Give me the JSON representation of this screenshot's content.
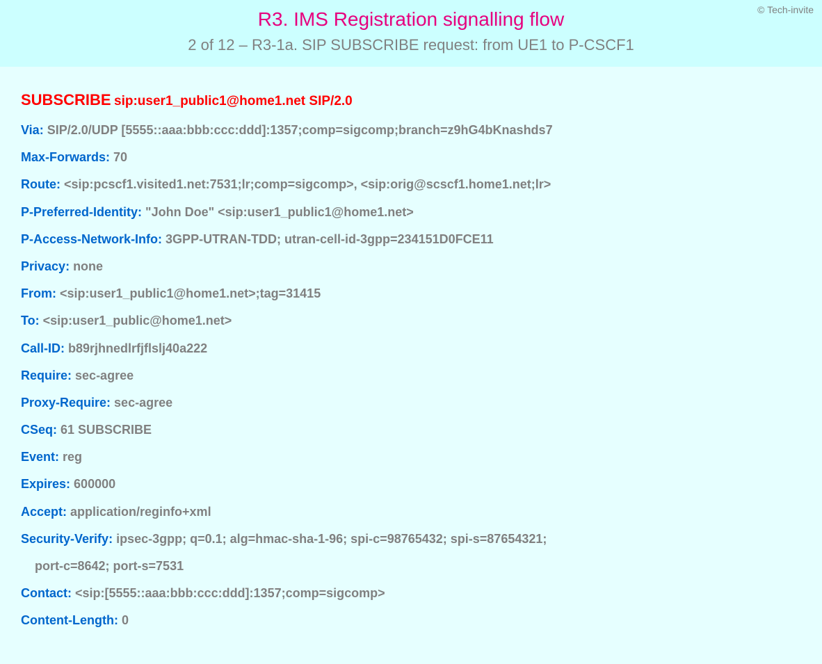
{
  "copyright": "© Tech-invite",
  "header": {
    "title": "R3. IMS Registration signalling flow",
    "subtitle": "2 of 12 – R3-1a. SIP SUBSCRIBE request: from UE1 to P-CSCF1"
  },
  "request": {
    "method": "SUBSCRIBE",
    "uri": "sip:user1_public1@home1.net SIP/2.0"
  },
  "sip_headers": [
    {
      "name": "Via",
      "value": "SIP/2.0/UDP [5555::aaa:bbb:ccc:ddd]:1357;comp=sigcomp;branch=z9hG4bKnashds7"
    },
    {
      "name": "Max-Forwards",
      "value": "70"
    },
    {
      "name": "Route",
      "value": "<sip:pcscf1.visited1.net:7531;lr;comp=sigcomp>, <sip:orig@scscf1.home1.net;lr>"
    },
    {
      "name": "P-Preferred-Identity",
      "value": "\"John Doe\" <sip:user1_public1@home1.net>"
    },
    {
      "name": "P-Access-Network-Info",
      "value": "3GPP-UTRAN-TDD; utran-cell-id-3gpp=234151D0FCE11"
    },
    {
      "name": "Privacy",
      "value": "none"
    },
    {
      "name": "From",
      "value": "<sip:user1_public1@home1.net>;tag=31415"
    },
    {
      "name": "To",
      "value": "<sip:user1_public@home1.net>"
    },
    {
      "name": "Call-ID",
      "value": "b89rjhnedlrfjflslj40a222"
    },
    {
      "name": "Require",
      "value": "sec-agree"
    },
    {
      "name": "Proxy-Require",
      "value": "sec-agree"
    },
    {
      "name": "CSeq",
      "value": "61 SUBSCRIBE"
    },
    {
      "name": "Event",
      "value": "reg"
    },
    {
      "name": "Expires",
      "value": "600000"
    },
    {
      "name": "Accept",
      "value": "application/reginfo+xml"
    },
    {
      "name": "Security-Verify",
      "value": "ipsec-3gpp; q=0.1; alg=hmac-sha-1-96; spi-c=98765432; spi-s=87654321;",
      "cont": "port-c=8642; port-s=7531"
    },
    {
      "name": "Contact",
      "value": "<sip:[5555::aaa:bbb:ccc:ddd]:1357;comp=sigcomp>"
    },
    {
      "name": "Content-Length",
      "value": "0"
    }
  ]
}
